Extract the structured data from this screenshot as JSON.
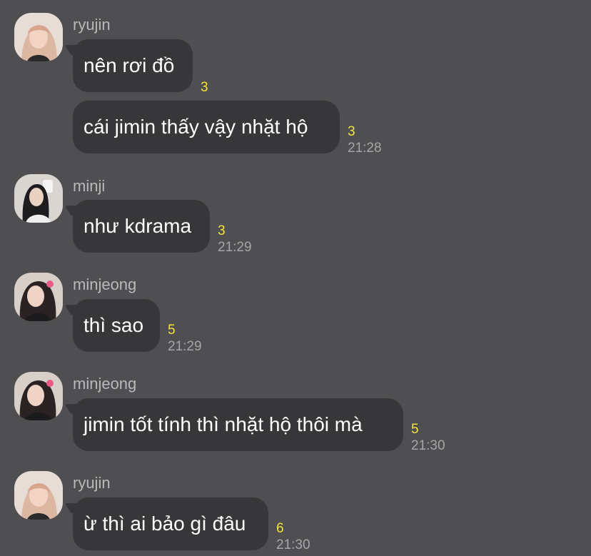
{
  "colors": {
    "background": "#4f4e50",
    "bubble": "#373638",
    "unread": "#f5e53a",
    "meta_text": "#a6a5a7"
  },
  "groups": [
    {
      "sender": "ryujin",
      "avatar": "ryujin-avatar",
      "messages": [
        {
          "text": "nên rơi đồ",
          "unread": "3",
          "time": ""
        },
        {
          "text": "cái jimin thấy vậy nhặt hộ",
          "unread": "3",
          "time": "21:28"
        }
      ]
    },
    {
      "sender": "minji",
      "avatar": "minji-avatar",
      "messages": [
        {
          "text": "như kdrama",
          "unread": "3",
          "time": "21:29"
        }
      ]
    },
    {
      "sender": "minjeong",
      "avatar": "minjeong-avatar",
      "messages": [
        {
          "text": "thì sao",
          "unread": "5",
          "time": "21:29"
        }
      ]
    },
    {
      "sender": "minjeong",
      "avatar": "minjeong-avatar",
      "messages": [
        {
          "text": "jimin tốt tính thì nhặt hộ thôi mà",
          "unread": "5",
          "time": "21:30"
        }
      ]
    },
    {
      "sender": "ryujin",
      "avatar": "ryujin-avatar",
      "messages": [
        {
          "text": "ừ thì ai bảo gì đâu",
          "unread": "6",
          "time": "21:30"
        }
      ]
    }
  ]
}
